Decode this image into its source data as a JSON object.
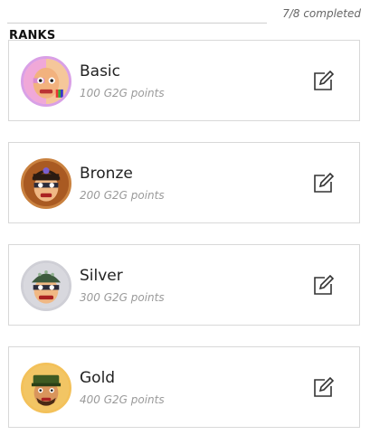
{
  "header": {
    "progress": "7/8 completed",
    "section_title": "RANKS"
  },
  "ranks": [
    {
      "name": "Basic",
      "points": "100 G2G points",
      "icon": "basic-rank-avatar",
      "color": "#d9a0e6"
    },
    {
      "name": "Bronze",
      "points": "200 G2G points",
      "icon": "bronze-rank-avatar",
      "color": "#c9813f"
    },
    {
      "name": "Silver",
      "points": "300 G2G points",
      "icon": "silver-rank-avatar",
      "color": "#cfcfd6"
    },
    {
      "name": "Gold",
      "points": "400 G2G points",
      "icon": "gold-rank-avatar",
      "color": "#f3c15a"
    }
  ]
}
